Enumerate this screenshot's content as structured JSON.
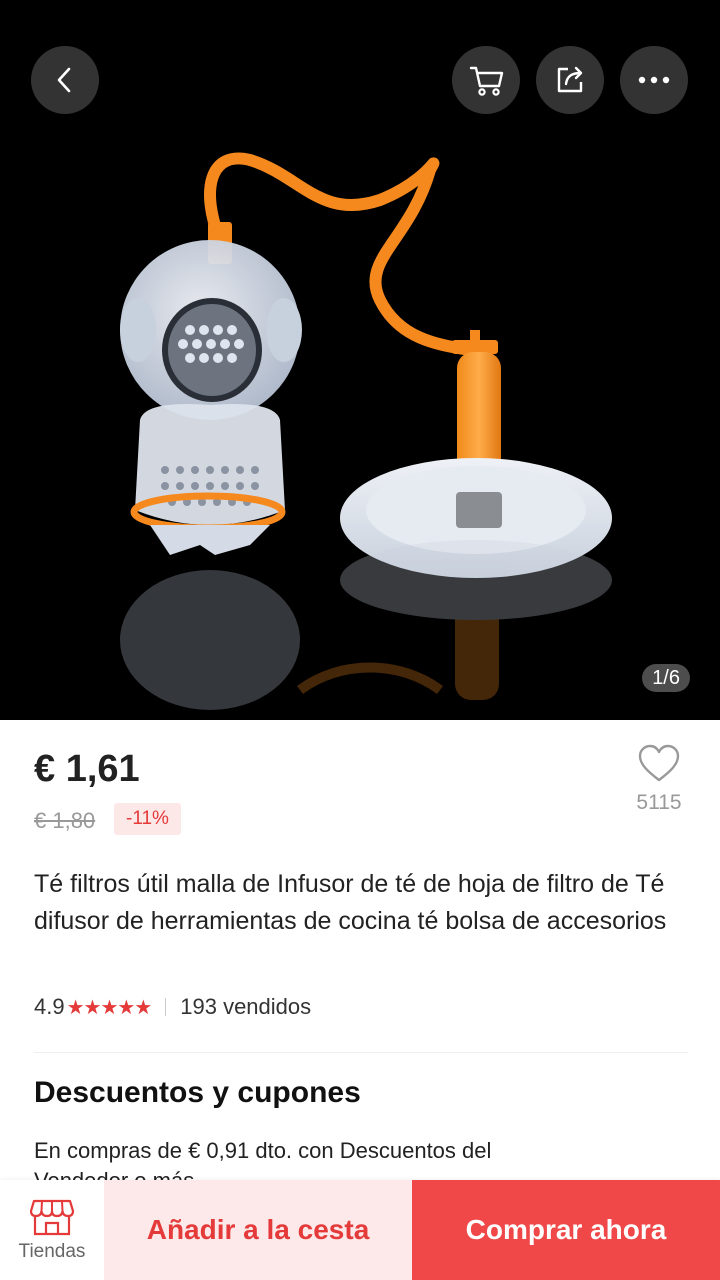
{
  "hero": {
    "image_alt": "diver tea infuser with plate",
    "pager": "1/6",
    "icons": [
      "chevron-left-icon",
      "cart-icon",
      "share-icon",
      "more-icon"
    ]
  },
  "product": {
    "price": "€ 1,61",
    "old_price": "€ 1,80",
    "discount": "-11%",
    "wishlist_count": "5115",
    "title": "Té filtros útil malla de Infusor de té de hoja de filtro de Té difusor de herramientas de cocina té bolsa de accesorios",
    "rating": "4.9",
    "stars": "★★★★★",
    "sold": "193 vendidos"
  },
  "coupons": {
    "title": "Descuentos y cupones",
    "text": "En compras de € 0,91 dto. con Descuentos del Vendedor o más"
  },
  "bottom_bar": {
    "store_label": "Tiendas",
    "add_to_cart": "Añadir a la cesta",
    "buy_now": "Comprar ahora"
  },
  "colors": {
    "accent": "#e43a3a",
    "buy_button": "#f04848",
    "cart_button_bg": "#fde9e9"
  }
}
